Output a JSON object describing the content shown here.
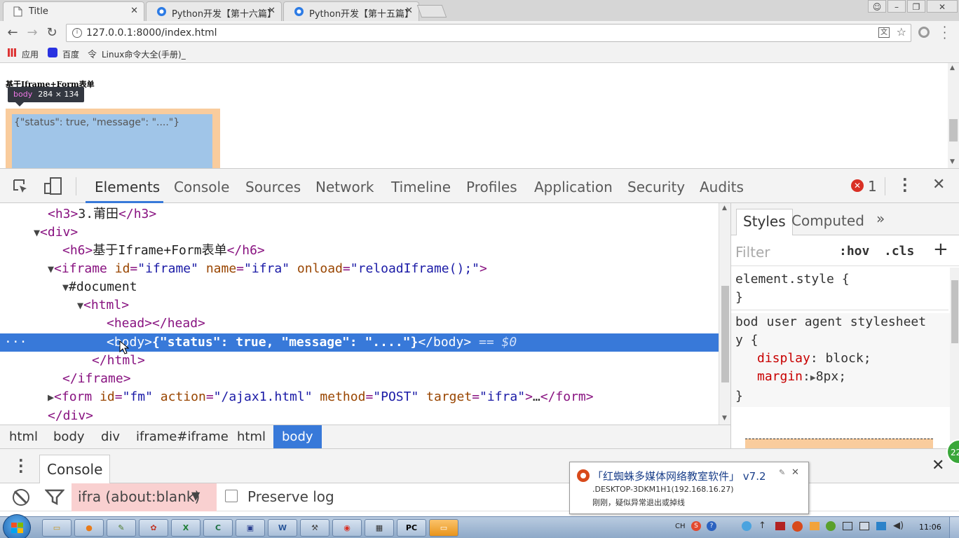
{
  "browser": {
    "tabs": [
      {
        "title": "Title"
      },
      {
        "title": "Python开发【第十六篇】"
      },
      {
        "title": "Python开发【第十五篇】"
      }
    ],
    "url": "127.0.0.1:8000/index.html",
    "bookmarks": [
      {
        "label": "应用"
      },
      {
        "label": "百度"
      },
      {
        "label": "Linux命令大全(手册)_"
      }
    ]
  },
  "page": {
    "heading": "基于Iframe+Form表单",
    "tooltip_tag": "body",
    "tooltip_size": "284 × 134",
    "iframe_text": "{\"status\": true, \"message\": \"....\"}"
  },
  "devtools": {
    "tabs": [
      "Elements",
      "Console",
      "Sources",
      "Network",
      "Timeline",
      "Profiles",
      "Application",
      "Security",
      "Audits"
    ],
    "error_count": "1",
    "dom": {
      "l1_text": "3.莆田",
      "l3_text": "基于Iframe+Form表单",
      "iframe_id": "\"iframe\"",
      "iframe_name": "\"ifra\"",
      "iframe_onload": "\"reloadIframe();\"",
      "document": "#document",
      "body_text": "{\"status\": true, \"message\": \"....\"}",
      "eq": "== $0",
      "form_id": "\"fm\"",
      "form_action": "\"/ajax1.html\"",
      "form_method": "\"POST\"",
      "form_target": "\"ifra\"",
      "ellipsis": "…"
    },
    "breadcrumbs": [
      "html",
      "body",
      "div",
      "iframe#iframe",
      "html",
      "body"
    ],
    "styles": {
      "tabs": [
        "Styles",
        "Computed"
      ],
      "filter_placeholder": "Filter",
      "hov": ":hov",
      "cls": ".cls",
      "element_style": "element.style {",
      "close_brace": "}",
      "rule_selector": "bod",
      "rule_selector_wrap": "y {",
      "rule_source": "user agent stylesheet",
      "prop1_name": "display",
      "prop1_value": "block;",
      "prop2_name": "margin",
      "prop2_value": "8px;"
    },
    "console": {
      "title": "Console",
      "context": "ifra (about:blank)",
      "preserve_log": "Preserve log"
    }
  },
  "notification": {
    "title": "「红蜘蛛多媒体网络教室软件」 v7.2",
    "host": ".DESKTOP-3DKM1H1(192.168.16.27)",
    "message": "刚刚，疑似异常退出或掉线"
  },
  "taskbar": {
    "lang": "CH",
    "time": "11:06",
    "badge": "22"
  }
}
